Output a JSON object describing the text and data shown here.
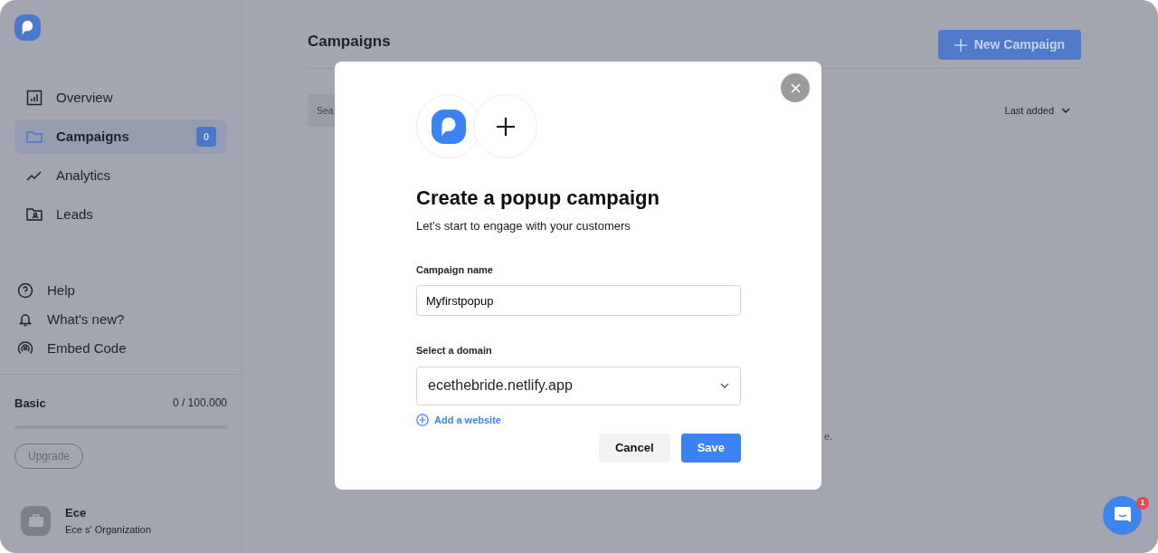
{
  "sidebar": {
    "items": [
      {
        "label": "Overview",
        "selected": false
      },
      {
        "label": "Campaigns",
        "selected": true,
        "badge": "0"
      },
      {
        "label": "Analytics",
        "selected": false
      },
      {
        "label": "Leads",
        "selected": false
      }
    ],
    "links": [
      {
        "label": "Help"
      },
      {
        "label": "What's new?"
      },
      {
        "label": "Embed Code"
      }
    ],
    "plan": {
      "name": "Basic",
      "usage": "0 / 100.000",
      "level": 0,
      "button": "Upgrade"
    },
    "user": {
      "name": "Ece",
      "org": "Ece s' Organization"
    }
  },
  "main": {
    "title": "Campaigns",
    "new_button": "New Campaign",
    "search": {
      "placeholder": "Sea"
    },
    "sort": "Last added",
    "hidden_text": "e."
  },
  "modal": {
    "title": "Create a popup campaign",
    "subtitle": "Let’s start to engage with your customers",
    "name_label": "Campaign name",
    "name_value": "Myfirstpopup",
    "domain_label": "Select a domain",
    "domain_value": "ecethebride.netlify.app",
    "add_link": "Add a website",
    "buttons": [
      {
        "label": "Cancel",
        "kind": "secondary"
      },
      {
        "label": "Save",
        "kind": "primary"
      }
    ]
  },
  "chat": {
    "badge": "1"
  }
}
